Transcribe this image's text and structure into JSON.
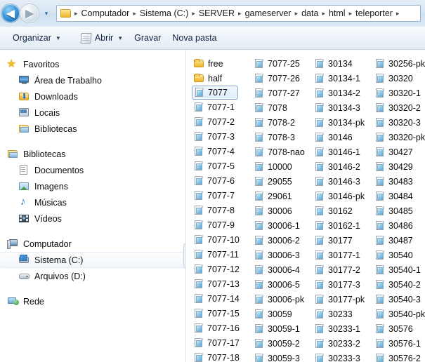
{
  "addressbar": {
    "back_label": "◀",
    "forward_label": "▶",
    "history_label": "▾",
    "folder_icon": "folder-icon",
    "breadcrumbs": [
      "Computador",
      "Sistema (C:)",
      "SERVER",
      "gameserver",
      "data",
      "html",
      "teleporter"
    ],
    "separator": "▸"
  },
  "toolbar": {
    "organize_label": "Organizar",
    "open_label": "Abrir",
    "burn_label": "Gravar",
    "new_folder_label": "Nova pasta",
    "caret": "▼"
  },
  "sidebar": {
    "groups": [
      {
        "header": {
          "label": "Favoritos",
          "icon": "star-icon"
        },
        "items": [
          {
            "label": "Área de Trabalho",
            "icon": "desktop-icon"
          },
          {
            "label": "Downloads",
            "icon": "downloads-icon"
          },
          {
            "label": "Locais",
            "icon": "places-icon"
          },
          {
            "label": "Bibliotecas",
            "icon": "libraries-icon"
          }
        ]
      },
      {
        "header": {
          "label": "Bibliotecas",
          "icon": "libraries-icon"
        },
        "items": [
          {
            "label": "Documentos",
            "icon": "document-icon"
          },
          {
            "label": "Imagens",
            "icon": "image-icon"
          },
          {
            "label": "Músicas",
            "icon": "music-icon"
          },
          {
            "label": "Vídeos",
            "icon": "video-icon"
          }
        ]
      },
      {
        "header": {
          "label": "Computador",
          "icon": "computer-icon"
        },
        "items": [
          {
            "label": "Sistema (C:)",
            "icon": "system-drive-icon",
            "hovered": true
          },
          {
            "label": "Arquivos (D:)",
            "icon": "drive-icon"
          }
        ]
      },
      {
        "header": {
          "label": "Rede",
          "icon": "network-icon"
        },
        "items": []
      }
    ]
  },
  "filelist": {
    "columns": [
      {
        "items": [
          {
            "name": "free",
            "type": "folder"
          },
          {
            "name": "half",
            "type": "folder"
          },
          {
            "name": "7077",
            "type": "file",
            "selected": true
          },
          {
            "name": "7077-1",
            "type": "file"
          },
          {
            "name": "7077-2",
            "type": "file"
          },
          {
            "name": "7077-3",
            "type": "file"
          },
          {
            "name": "7077-4",
            "type": "file"
          },
          {
            "name": "7077-5",
            "type": "file"
          },
          {
            "name": "7077-6",
            "type": "file"
          },
          {
            "name": "7077-7",
            "type": "file"
          },
          {
            "name": "7077-8",
            "type": "file"
          },
          {
            "name": "7077-9",
            "type": "file"
          },
          {
            "name": "7077-10",
            "type": "file"
          },
          {
            "name": "7077-11",
            "type": "file"
          },
          {
            "name": "7077-12",
            "type": "file"
          },
          {
            "name": "7077-13",
            "type": "file"
          },
          {
            "name": "7077-14",
            "type": "file"
          },
          {
            "name": "7077-15",
            "type": "file"
          },
          {
            "name": "7077-16",
            "type": "file"
          },
          {
            "name": "7077-17",
            "type": "file"
          },
          {
            "name": "7077-18",
            "type": "file"
          }
        ]
      },
      {
        "items": [
          {
            "name": "7077-25",
            "type": "file"
          },
          {
            "name": "7077-26",
            "type": "file"
          },
          {
            "name": "7077-27",
            "type": "file"
          },
          {
            "name": "7078",
            "type": "file"
          },
          {
            "name": "7078-2",
            "type": "file"
          },
          {
            "name": "7078-3",
            "type": "file"
          },
          {
            "name": "7078-nao",
            "type": "file"
          },
          {
            "name": "10000",
            "type": "file"
          },
          {
            "name": "29055",
            "type": "file"
          },
          {
            "name": "29061",
            "type": "file"
          },
          {
            "name": "30006",
            "type": "file"
          },
          {
            "name": "30006-1",
            "type": "file"
          },
          {
            "name": "30006-2",
            "type": "file"
          },
          {
            "name": "30006-3",
            "type": "file"
          },
          {
            "name": "30006-4",
            "type": "file"
          },
          {
            "name": "30006-5",
            "type": "file"
          },
          {
            "name": "30006-pk",
            "type": "file"
          },
          {
            "name": "30059",
            "type": "file"
          },
          {
            "name": "30059-1",
            "type": "file"
          },
          {
            "name": "30059-2",
            "type": "file"
          },
          {
            "name": "30059-3",
            "type": "file"
          }
        ]
      },
      {
        "items": [
          {
            "name": "30134",
            "type": "file"
          },
          {
            "name": "30134-1",
            "type": "file"
          },
          {
            "name": "30134-2",
            "type": "file"
          },
          {
            "name": "30134-3",
            "type": "file"
          },
          {
            "name": "30134-pk",
            "type": "file"
          },
          {
            "name": "30146",
            "type": "file"
          },
          {
            "name": "30146-1",
            "type": "file"
          },
          {
            "name": "30146-2",
            "type": "file"
          },
          {
            "name": "30146-3",
            "type": "file"
          },
          {
            "name": "30146-pk",
            "type": "file"
          },
          {
            "name": "30162",
            "type": "file"
          },
          {
            "name": "30162-1",
            "type": "file"
          },
          {
            "name": "30177",
            "type": "file"
          },
          {
            "name": "30177-1",
            "type": "file"
          },
          {
            "name": "30177-2",
            "type": "file"
          },
          {
            "name": "30177-3",
            "type": "file"
          },
          {
            "name": "30177-pk",
            "type": "file"
          },
          {
            "name": "30233",
            "type": "file"
          },
          {
            "name": "30233-1",
            "type": "file"
          },
          {
            "name": "30233-2",
            "type": "file"
          },
          {
            "name": "30233-3",
            "type": "file"
          }
        ]
      },
      {
        "items": [
          {
            "name": "30256-pk",
            "type": "file"
          },
          {
            "name": "30320",
            "type": "file"
          },
          {
            "name": "30320-1",
            "type": "file"
          },
          {
            "name": "30320-2",
            "type": "file"
          },
          {
            "name": "30320-3",
            "type": "file"
          },
          {
            "name": "30320-pk",
            "type": "file"
          },
          {
            "name": "30427",
            "type": "file"
          },
          {
            "name": "30429",
            "type": "file"
          },
          {
            "name": "30483",
            "type": "file"
          },
          {
            "name": "30484",
            "type": "file"
          },
          {
            "name": "30485",
            "type": "file"
          },
          {
            "name": "30486",
            "type": "file"
          },
          {
            "name": "30487",
            "type": "file"
          },
          {
            "name": "30540",
            "type": "file"
          },
          {
            "name": "30540-1",
            "type": "file"
          },
          {
            "name": "30540-2",
            "type": "file"
          },
          {
            "name": "30540-3",
            "type": "file"
          },
          {
            "name": "30540-pk",
            "type": "file"
          },
          {
            "name": "30576",
            "type": "file"
          },
          {
            "name": "30576-1",
            "type": "file"
          },
          {
            "name": "30576-2",
            "type": "file"
          }
        ]
      }
    ]
  },
  "colors": {
    "accent_blue": "#2f8ed6",
    "selection_border": "#7da2ce",
    "selection_fill": "#dceefb",
    "folder_yellow": "#f7cf63",
    "chrome_blue": "#d6e4f2"
  }
}
